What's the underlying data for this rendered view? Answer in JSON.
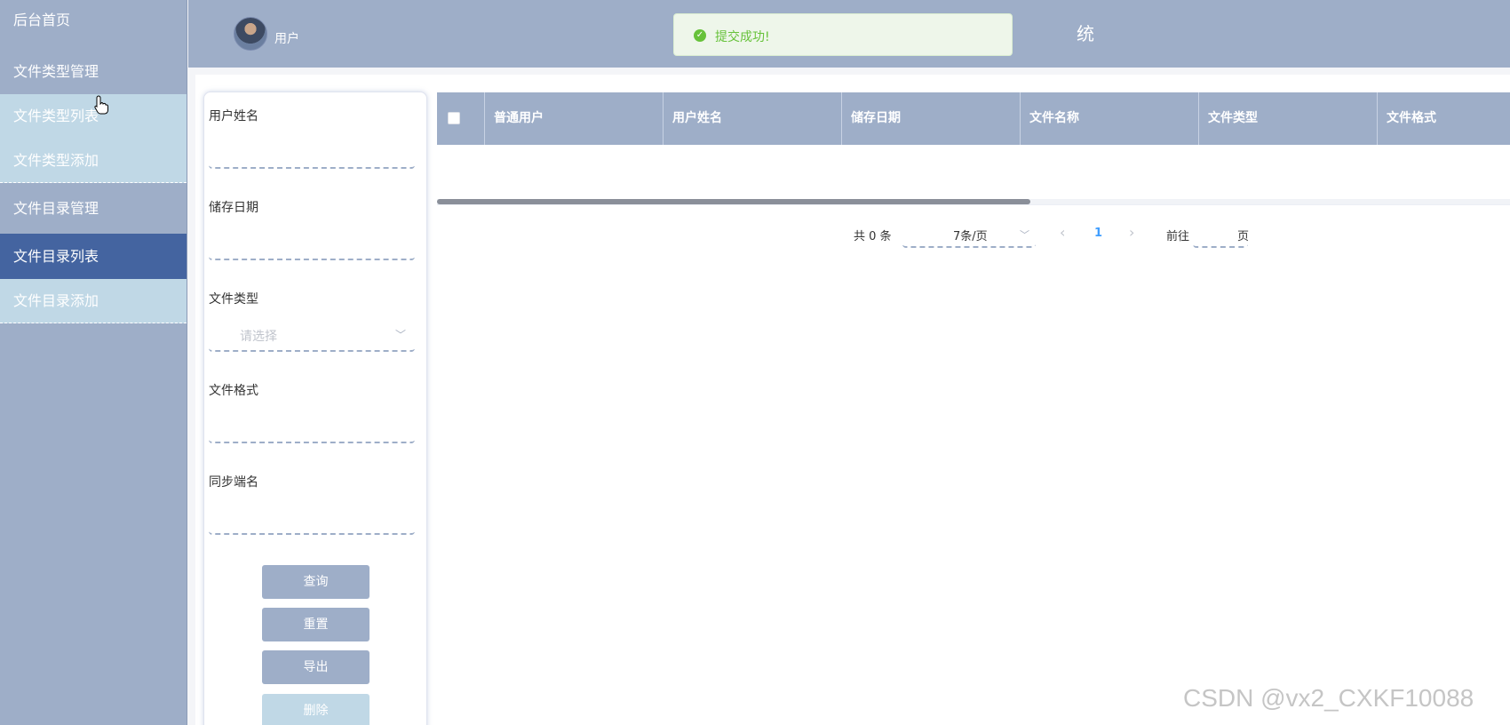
{
  "sidebar": {
    "items": [
      {
        "label": "后台首页"
      },
      {
        "label": "文件类型管理"
      },
      {
        "label": "文件类型列表"
      },
      {
        "label": "文件类型添加"
      },
      {
        "label": "文件目录管理"
      },
      {
        "label": "文件目录列表"
      },
      {
        "label": "文件目录添加"
      }
    ]
  },
  "header": {
    "username": "用户",
    "title_visible_fragment": "统"
  },
  "toast": {
    "message": "提交成功!",
    "icon": "check-circle-icon",
    "color": "#67c23a"
  },
  "search": {
    "fields": [
      {
        "label": "用户姓名",
        "value": "",
        "placeholder": ""
      },
      {
        "label": "储存日期",
        "value": "",
        "placeholder": ""
      },
      {
        "label": "文件类型",
        "value": "",
        "placeholder": "请选择"
      },
      {
        "label": "文件格式",
        "value": "",
        "placeholder": ""
      },
      {
        "label": "同步端名",
        "value": "",
        "placeholder": ""
      }
    ],
    "buttons": {
      "query": "查询",
      "reset": "重置",
      "export": "导出",
      "delete": "删除"
    }
  },
  "table": {
    "columns": [
      "普通用户",
      "用户姓名",
      "储存日期",
      "文件名称",
      "文件类型",
      "文件格式"
    ],
    "rows": []
  },
  "pagination": {
    "total_text": "共 0 条",
    "page_size": "7条/页",
    "current_page": "1",
    "goto_label": "前往",
    "goto_suffix": "页",
    "goto_value": ""
  },
  "watermark": "CSDN @vx2_CXKF10088",
  "colors": {
    "accent": "#9eaec8",
    "active": "#4464a0",
    "sub_menu": "#c0d8e6",
    "link": "#409eff"
  }
}
